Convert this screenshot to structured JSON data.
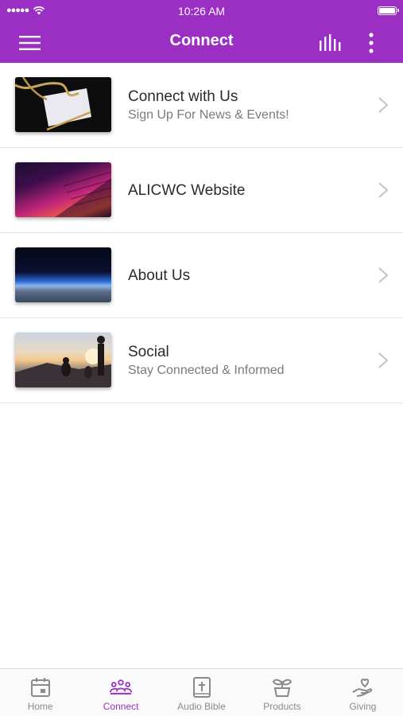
{
  "status_bar": {
    "signal": "●●●●●",
    "time": "10:26 AM"
  },
  "nav_bar": {
    "title": "Connect"
  },
  "list": [
    {
      "title": "Connect with Us",
      "subtitle": "Sign Up For News & Events!"
    },
    {
      "title": "ALICWC Website",
      "subtitle": ""
    },
    {
      "title": "About Us",
      "subtitle": ""
    },
    {
      "title": "Social",
      "subtitle": "Stay Connected & Informed"
    }
  ],
  "tabs": [
    {
      "label": "Home",
      "icon": "calendar-icon",
      "active": false
    },
    {
      "label": "Connect",
      "icon": "people-icon",
      "active": true
    },
    {
      "label": "Audio Bible",
      "icon": "bible-icon",
      "active": false
    },
    {
      "label": "Products",
      "icon": "plant-icon",
      "active": false
    },
    {
      "label": "Giving",
      "icon": "giving-hand-icon",
      "active": false
    }
  ],
  "colors": {
    "accent": "#9b2fc4",
    "inactive": "#8a8a8a"
  }
}
